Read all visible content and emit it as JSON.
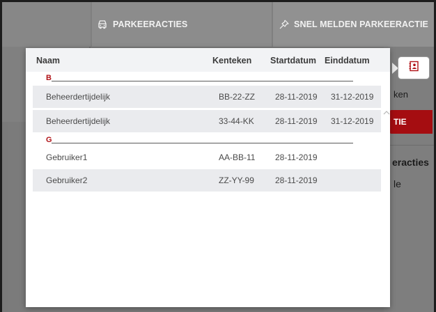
{
  "tabs": [
    {
      "label": "",
      "icon": "none"
    },
    {
      "label": "PARKEERACTIES",
      "icon": "car-icon"
    },
    {
      "label": "SNEL MELDEN PARKEERACTIE",
      "icon": "pin-icon"
    }
  ],
  "background": {
    "partial_text_1": "ken",
    "red_button_label": "TIE",
    "partial_heading": "eracties",
    "partial_text_2": "le",
    "contact_icon": "contact-book-icon"
  },
  "modal": {
    "columns": {
      "naam": "Naam",
      "kenteken": "Kenteken",
      "startdatum": "Startdatum",
      "einddatum": "Einddatum"
    },
    "groups": [
      {
        "letter": "B",
        "rows": [
          {
            "naam": "Beheerdertijdelijk",
            "kenteken": "BB-22-ZZ",
            "startdatum": "28-11-2019",
            "einddatum": "31-12-2019"
          },
          {
            "naam": "Beheerdertijdelijk",
            "kenteken": "33-44-KK",
            "startdatum": "28-11-2019",
            "einddatum": "31-12-2019"
          }
        ]
      },
      {
        "letter": "G",
        "rows": [
          {
            "naam": "Gebruiker1",
            "kenteken": "AA-BB-11",
            "startdatum": "28-11-2019",
            "einddatum": ""
          },
          {
            "naam": "Gebruiker2",
            "kenteken": "ZZ-YY-99",
            "startdatum": "28-11-2019",
            "einddatum": ""
          }
        ]
      }
    ]
  },
  "colors": {
    "accent_red": "#b01116",
    "header_bg": "#f2f3f5",
    "alt_row_bg": "#eaebee"
  }
}
